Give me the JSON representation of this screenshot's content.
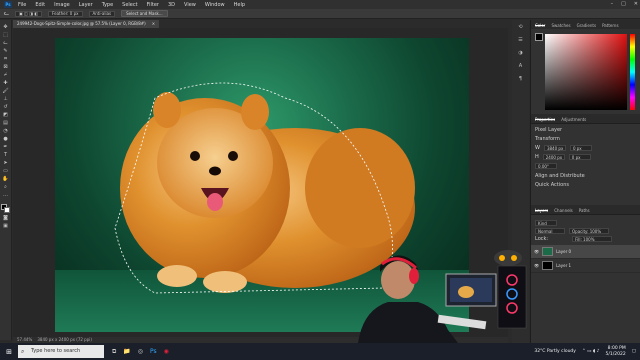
{
  "menubar": {
    "logo": "Ps",
    "items": [
      "File",
      "Edit",
      "Image",
      "Layer",
      "Type",
      "Select",
      "Filter",
      "3D",
      "View",
      "Window",
      "Help"
    ]
  },
  "options": {
    "feather": "Feather: 0 px",
    "antialias": "Anti-alias",
    "style": "Style: Normal",
    "select_mask": "Select and Mask..."
  },
  "document": {
    "tab_title": "249942-Dogs-Spitz-Simple-color.jpg @ 57.5% (Layer 0, RGB/8#)",
    "close": "×",
    "zoom": "57.44%",
    "info": "3840 px x 2400 px (72 ppi)"
  },
  "panels": {
    "color_tabs": [
      "Color",
      "Swatches",
      "Gradients",
      "Patterns"
    ],
    "properties_tabs": [
      "Properties",
      "Adjustments"
    ],
    "pixel_layer": "Pixel Layer",
    "transform": "Transform",
    "align": "Align and Distribute",
    "quick_actions": "Quick Actions",
    "w": "W",
    "h": "H",
    "w_val": "3840 px",
    "h_val": "2400 px",
    "x_val": "0 px",
    "y_val": "0 px",
    "angle": "0.00°",
    "layers_tabs": [
      "Layers",
      "Channels",
      "Paths"
    ],
    "kind": "Kind",
    "blend": "Normal",
    "opacity": "Opacity: 100%",
    "lock": "Lock:",
    "fill": "Fill: 100%",
    "layers": [
      "Layer 0",
      "Layer 1"
    ]
  },
  "taskbar": {
    "search_placeholder": "Type here to search",
    "weather": "32°C  Partly cloudy",
    "time": "8:00 PM",
    "date": "5/1/2022"
  },
  "colors": {
    "accent": "#31a8ff",
    "canvas_green": "#1c6e4c"
  }
}
